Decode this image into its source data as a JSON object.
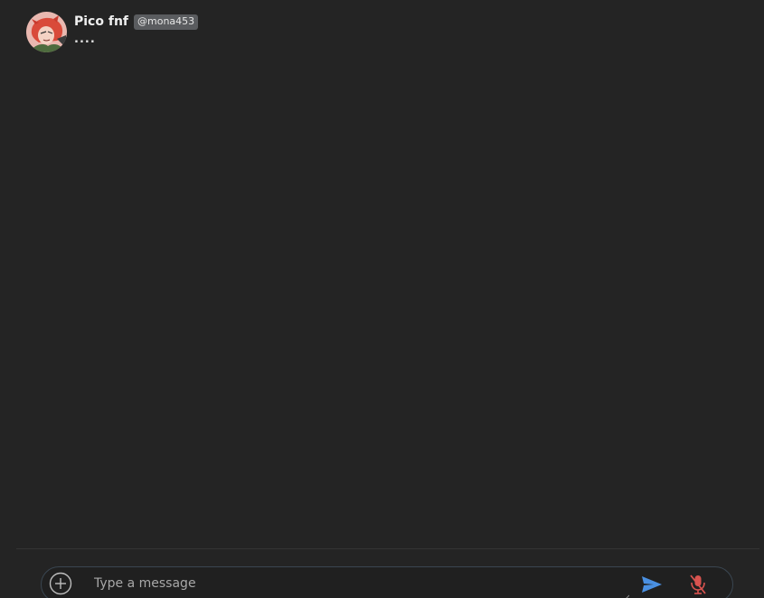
{
  "chat": {
    "messages": [
      {
        "author": "Pico fnf",
        "username": "@mona453",
        "text": "...."
      }
    ]
  },
  "composer": {
    "placeholder": "Type a message",
    "value": "",
    "attach_icon": "plus-circle-icon",
    "send_icon": "send-icon",
    "mic_icon": "mic-muted-icon"
  },
  "colors": {
    "background": "#242424",
    "send_accent": "#4a90e2",
    "mic_muted": "#d9534f",
    "username_badge_bg": "#5a5c5f"
  }
}
